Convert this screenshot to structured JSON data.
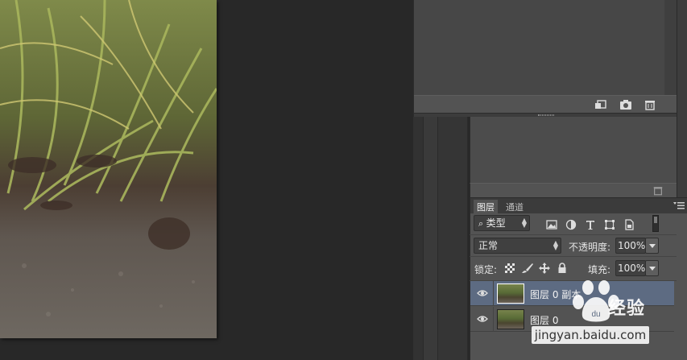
{
  "layers_panel": {
    "tabs": [
      {
        "label": "图层",
        "active": true
      },
      {
        "label": "通道",
        "active": false
      }
    ],
    "filter": {
      "kind_label": "类型"
    },
    "filter_icons": [
      "image-filter-icon",
      "adjustment-filter-icon",
      "type-filter-icon",
      "shape-filter-icon",
      "smartobject-filter-icon"
    ],
    "blend_mode": "正常",
    "opacity_label": "不透明度:",
    "opacity_value": "100%",
    "lock_label": "锁定:",
    "lock_icons": [
      "lock-transparent-icon",
      "lock-image-icon",
      "lock-position-icon",
      "lock-all-icon"
    ],
    "fill_label": "填充:",
    "fill_value": "100%",
    "layers": [
      {
        "name": "图层 0 副本",
        "selected": true,
        "visible": true
      },
      {
        "name": "图层 0",
        "selected": false,
        "visible": true
      }
    ]
  },
  "top_panel": {
    "footer_icons": [
      "new-snapshot-icon",
      "camera-icon",
      "trash-icon"
    ]
  },
  "upper_right_panel": {
    "footer_icons": [
      "trash-icon"
    ]
  },
  "watermark": {
    "brand": "经验",
    "url": "jingyan.baidu.com"
  },
  "colors": {
    "panel_bg": "#535353",
    "selected_row": "#5d6b82",
    "app_bg": "#282828"
  }
}
